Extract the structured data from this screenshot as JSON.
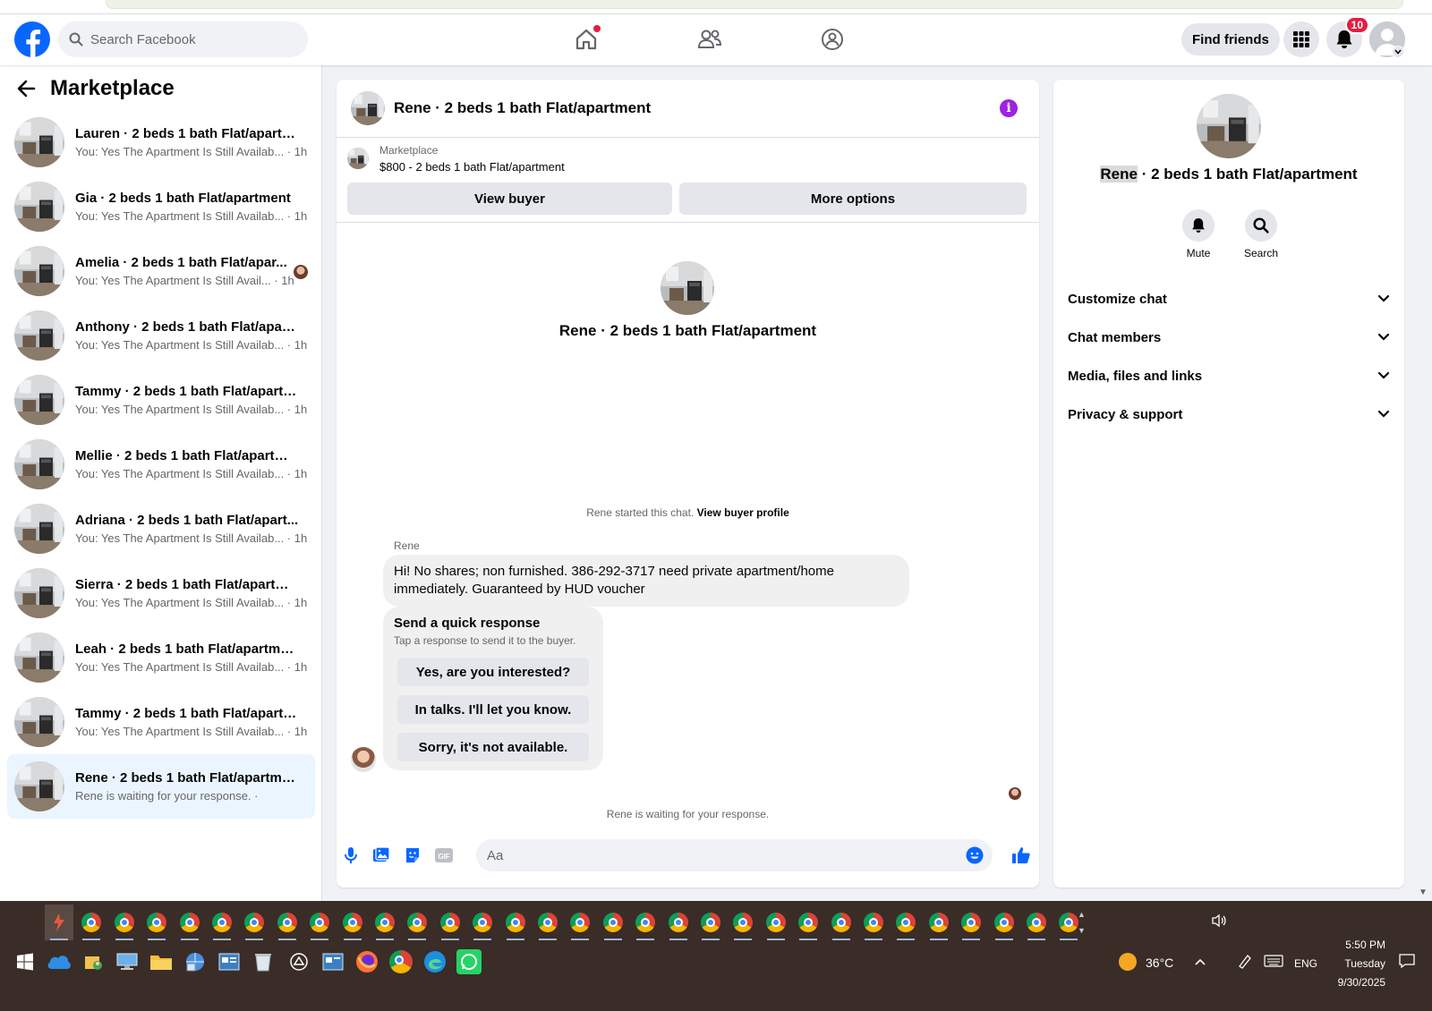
{
  "header": {
    "search_placeholder": "Search Facebook",
    "find_friends": "Find friends",
    "notification_count": "10"
  },
  "sidebar": {
    "title": "Marketplace",
    "threads": [
      {
        "title": "Lauren · 2 beds 1 bath Flat/apartm...",
        "preview": "You: Yes The Apartment Is Still Availab... · 1h"
      },
      {
        "title": "Gia · 2 beds 1 bath Flat/apartment",
        "preview": "You: Yes The Apartment Is Still Availab... · 1h"
      },
      {
        "title": "Amelia · 2 beds 1 bath Flat/apar...",
        "preview": "You: Yes The Apartment Is Still Avail... · 1h"
      },
      {
        "title": "Anthony · 2 beds 1 bath Flat/apart...",
        "preview": "You: Yes The Apartment Is Still Availab... · 1h"
      },
      {
        "title": "Tammy · 2 beds 1 bath Flat/apartm...",
        "preview": "You: Yes The Apartment Is Still Availab... · 1h"
      },
      {
        "title": "Mellie · 2 beds 1 bath Flat/apartme...",
        "preview": "You: Yes The Apartment Is Still Availab... · 1h"
      },
      {
        "title": "Adriana · 2 beds 1 bath Flat/apart...",
        "preview": "You: Yes The Apartment Is Still Availab... · 1h"
      },
      {
        "title": "Sierra · 2 beds 1 bath Flat/apartment",
        "preview": "You: Yes The Apartment Is Still Availab... · 1h"
      },
      {
        "title": "Leah · 2 beds 1 bath Flat/apartment",
        "preview": "You: Yes The Apartment Is Still Availab... · 1h"
      },
      {
        "title": "Tammy · 2 beds 1 bath Flat/apartm...",
        "preview": "You: Yes The Apartment Is Still Availab... · 1h"
      },
      {
        "title": "Rene · 2 beds 1 bath Flat/apartment",
        "preview": "Rene is waiting for your response. ·"
      }
    ]
  },
  "chat": {
    "title": "Rene · 2 beds 1 bath Flat/apartment",
    "listing_source": "Marketplace",
    "listing_detail": "$800 - 2 beds 1 bath Flat/apartment",
    "view_buyer": "View buyer",
    "more_options": "More options",
    "center_title": "Rene · 2 beds 1 bath Flat/apartment",
    "started_text": "Rene started this chat.",
    "view_buyer_profile": "View buyer profile",
    "sender": "Rene",
    "message": "Hi! No shares; non furnished. 386-292-3717 need private apartment/home immediately. Guaranteed by HUD voucher",
    "quick_title": "Send a quick response",
    "quick_subtitle": "Tap a response to send it to the buyer.",
    "quick_responses": [
      "Yes, are you interested?",
      "In talks. I'll let you know.",
      "Sorry, it's not available."
    ],
    "waiting": "Rene is waiting for your response.",
    "composer_placeholder": "Aa"
  },
  "info_panel": {
    "name_highlight": "Rene",
    "name_rest": " · 2 beds 1 bath Flat/apartment",
    "mute": "Mute",
    "search": "Search",
    "sections": [
      "Customize chat",
      "Chat members",
      "Media, files and links",
      "Privacy & support"
    ]
  },
  "taskbar": {
    "temperature": "36°C",
    "language": "ENG",
    "time": "5:50 PM",
    "day": "Tuesday",
    "date": "9/30/2025"
  },
  "colors": {
    "brand_blue": "#0866ff",
    "info_purple": "#9d22e3",
    "badge_red": "#e41e3f",
    "active_thread_bg": "#ebf5ff"
  }
}
